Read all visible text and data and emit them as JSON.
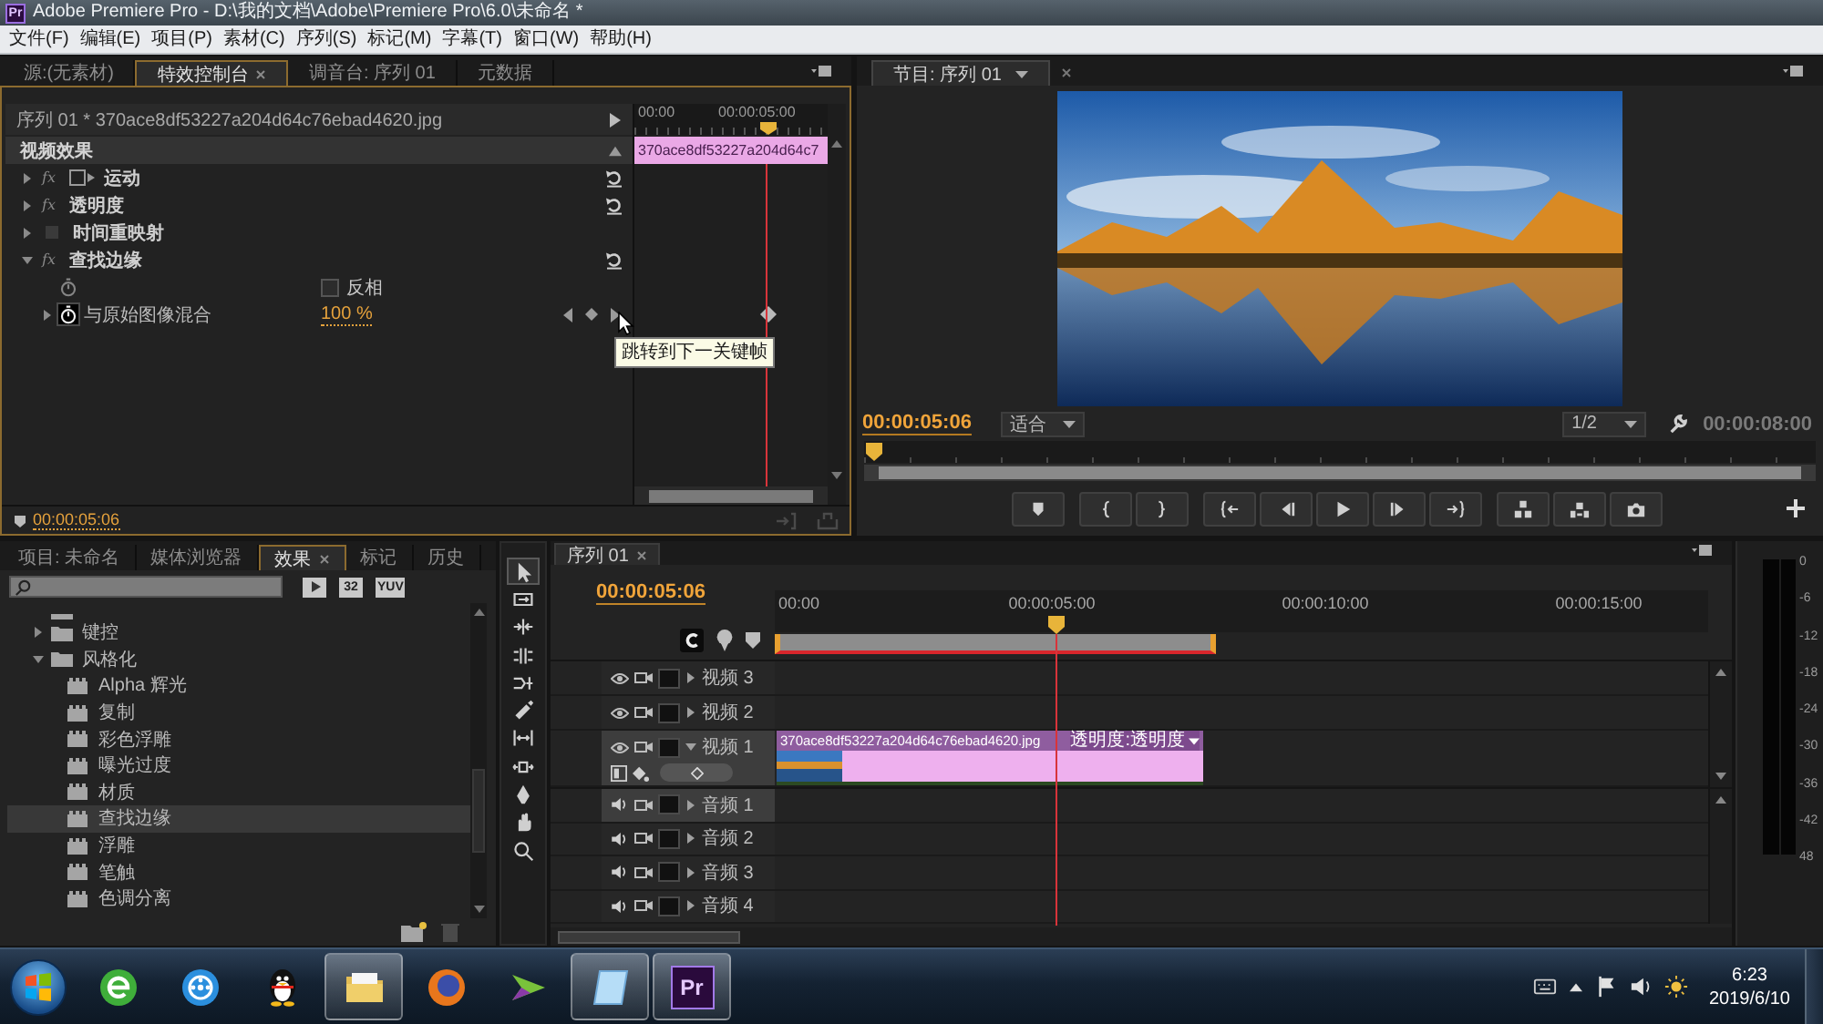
{
  "window": {
    "app_icon": "Pr",
    "title": "Adobe Premiere Pro - D:\\我的文档\\Adobe\\Premiere Pro\\6.0\\未命名 *"
  },
  "menu": [
    "文件(F)",
    "编辑(E)",
    "项目(P)",
    "素材(C)",
    "序列(S)",
    "标记(M)",
    "字幕(T)",
    "窗口(W)",
    "帮助(H)"
  ],
  "effect_controls": {
    "tabs": [
      {
        "label": "源:(无素材)",
        "selected": false
      },
      {
        "label": "特效控制台",
        "selected": true
      },
      {
        "label": "调音台: 序列 01",
        "selected": false
      },
      {
        "label": "元数据",
        "selected": false
      }
    ],
    "clip_path": "序列 01 * 370ace8df53227a204d64c76ebad4620.jpg",
    "ruler": [
      "00:00",
      "00:00:05:00"
    ],
    "section": "视频效果",
    "clip_bar": "370ace8df53227a204d64c7",
    "effects": [
      {
        "name": "运动",
        "kind": "motion",
        "badge": "fx",
        "expanded": false,
        "resettable": true
      },
      {
        "name": "透明度",
        "kind": "fx",
        "badge": "fx",
        "expanded": false,
        "resettable": true
      },
      {
        "name": "时间重映射",
        "kind": "fixed",
        "expanded": false,
        "resettable": false
      },
      {
        "name": "查找边缘",
        "kind": "fx",
        "badge": "fx",
        "expanded": true,
        "resettable": true,
        "params": [
          {
            "kind": "checkbox",
            "label": "反相",
            "checked": false,
            "animated": false
          },
          {
            "kind": "value",
            "label": "与原始图像混合",
            "value": "100 %",
            "expanded": false,
            "animated": true
          }
        ]
      }
    ],
    "tooltip": "跳转到下一关键帧",
    "timecode": "00:00:05:06"
  },
  "program": {
    "tab": "节目: 序列 01",
    "timecode": "00:00:05:06",
    "fit": "适合",
    "resolution": "1/2",
    "duration": "00:00:08:00"
  },
  "effects_panel": {
    "tabs": [
      {
        "label": "项目: 未命名",
        "selected": false
      },
      {
        "label": "媒体浏览器",
        "selected": false
      },
      {
        "label": "效果",
        "selected": true
      },
      {
        "label": "标记",
        "selected": false
      },
      {
        "label": "历史",
        "selected": false
      }
    ],
    "filters": [
      {
        "kind": "icon"
      },
      {
        "kind": "text",
        "label": "32"
      },
      {
        "kind": "text",
        "label": "YUV"
      }
    ],
    "tree": [
      {
        "label": "键控",
        "expanded": false,
        "selected": false
      },
      {
        "label": "风格化",
        "expanded": true,
        "selected": false,
        "children": [
          {
            "label": "Alpha 辉光",
            "selected": false
          },
          {
            "label": "复制",
            "selected": false
          },
          {
            "label": "彩色浮雕",
            "selected": false
          },
          {
            "label": "曝光过度",
            "selected": false
          },
          {
            "label": "材质",
            "selected": false
          },
          {
            "label": "查找边缘",
            "selected": true
          },
          {
            "label": "浮雕",
            "selected": false
          },
          {
            "label": "笔触",
            "selected": false
          },
          {
            "label": "色调分离",
            "selected": false
          }
        ]
      }
    ]
  },
  "tools": [
    {
      "kind": "selection",
      "selected": true
    },
    {
      "kind": "track_select",
      "selected": false
    },
    {
      "kind": "ripple",
      "selected": false
    },
    {
      "kind": "rolling",
      "selected": false
    },
    {
      "kind": "rate",
      "selected": false
    },
    {
      "kind": "razor",
      "selected": false
    },
    {
      "kind": "slip",
      "selected": false
    },
    {
      "kind": "slide",
      "selected": false
    },
    {
      "kind": "pen",
      "selected": false
    },
    {
      "kind": "hand",
      "selected": false
    },
    {
      "kind": "zoom",
      "selected": false
    }
  ],
  "timeline": {
    "tab": "序列 01",
    "timecode": "00:00:05:06",
    "ruler": [
      "00:00",
      "00:00:05:00",
      "00:00:10:00",
      "00:00:15:00"
    ],
    "tracks": [
      {
        "name": "视频 3",
        "kind": "video",
        "expanded": false,
        "selected": false
      },
      {
        "name": "视频 2",
        "kind": "video",
        "expanded": false,
        "selected": false
      },
      {
        "name": "视频 1",
        "kind": "video",
        "expanded": true,
        "selected": true,
        "clip": {
          "name": "370ace8df53227a204d64c76ebad4620.jpg",
          "property": "透明度:透明度"
        }
      },
      {
        "name": "音频 1",
        "kind": "audio",
        "expanded": false,
        "selected": true
      },
      {
        "name": "音频 2",
        "kind": "audio",
        "expanded": false,
        "selected": false
      },
      {
        "name": "音频 3",
        "kind": "audio",
        "expanded": false,
        "selected": false
      },
      {
        "name": "音频 4",
        "kind": "audio",
        "expanded": false,
        "selected": false
      }
    ]
  },
  "meter": {
    "scale": [
      "0",
      "-6",
      "-12",
      "-18",
      "-24",
      "-30",
      "-36",
      "-42",
      "48"
    ]
  },
  "taskbar": {
    "apps": [
      {
        "kind": "globe",
        "running": false
      },
      {
        "kind": "player",
        "running": false
      },
      {
        "kind": "penguin",
        "running": false
      },
      {
        "kind": "folder",
        "running": true
      },
      {
        "kind": "browser",
        "running": false
      },
      {
        "kind": "arrow",
        "running": false
      },
      {
        "kind": "notebook",
        "running": true
      },
      {
        "kind": "premiere",
        "label": "Pr",
        "running": true
      }
    ],
    "time": "6:23",
    "date": "2019/6/10"
  }
}
